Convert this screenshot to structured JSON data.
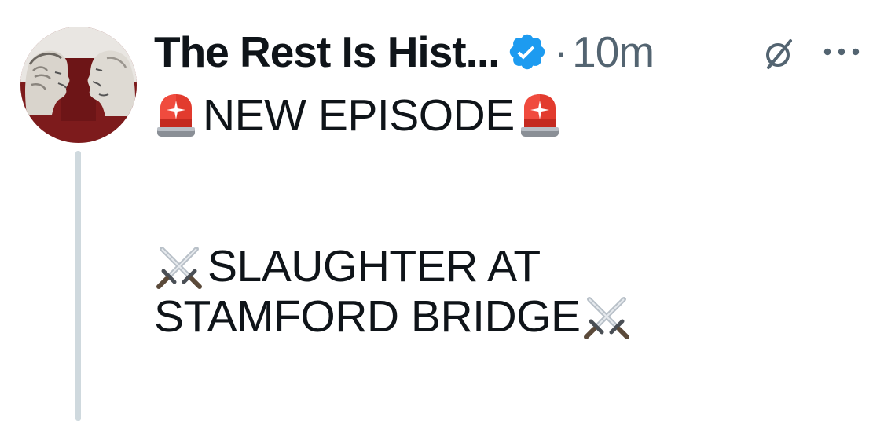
{
  "post": {
    "author_name": "The Rest Is Hist...",
    "separator": "·",
    "timestamp": "10m",
    "verified": true,
    "accent_color": "#1d9bf0",
    "icons": {
      "verified": "verified-badge-icon",
      "grok": "grok-icon",
      "more": "more-options-icon",
      "siren": "police-light-emoji",
      "swords": "crossed-swords-emoji"
    },
    "lines": {
      "line1": "NEW EPISODE",
      "line2": "SLAUGHTER AT",
      "line3": "STAMFORD BRIDGE"
    }
  }
}
